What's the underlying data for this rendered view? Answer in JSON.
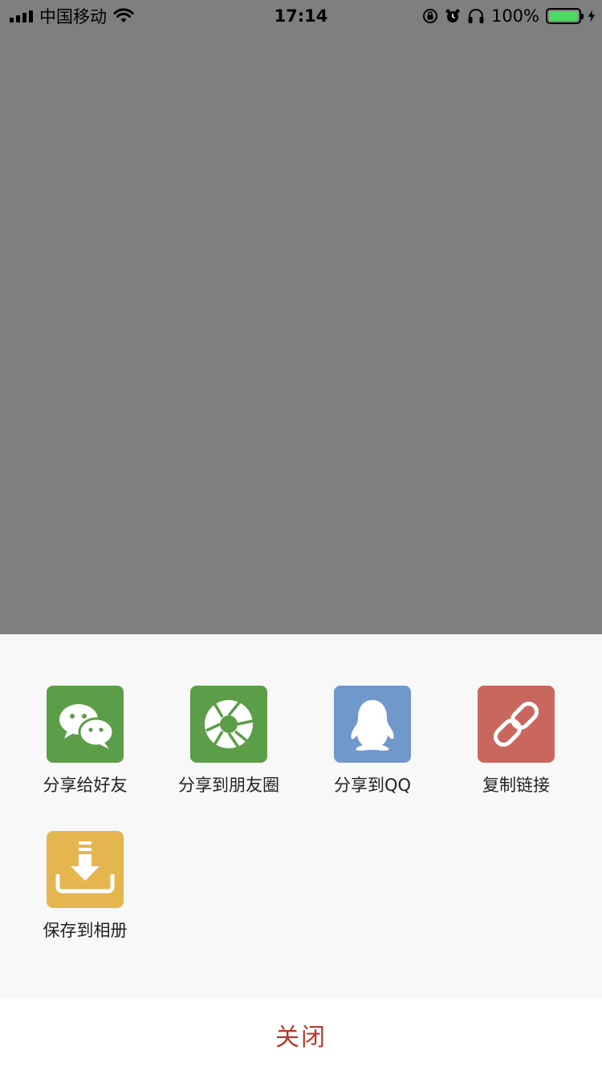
{
  "status_bar": {
    "carrier": "中国移动",
    "time": "17:14",
    "battery": "100%",
    "battery_level": 1.0,
    "icons": [
      "signal-icon",
      "wifi-icon",
      "orientation-lock-icon",
      "alarm-icon",
      "headphones-icon",
      "battery-icon",
      "charging-icon"
    ]
  },
  "share_sheet": {
    "items": [
      {
        "label": "分享给好友",
        "icon": "wechat-icon",
        "color": "#5b9e47"
      },
      {
        "label": "分享到朋友圈",
        "icon": "moments-icon",
        "color": "#5b9e47"
      },
      {
        "label": "分享到QQ",
        "icon": "qq-icon",
        "color": "#7098cb"
      },
      {
        "label": "复制链接",
        "icon": "link-icon",
        "color": "#c9675f"
      },
      {
        "label": "保存到相册",
        "icon": "download-icon",
        "color": "#e5b64f"
      }
    ],
    "close_label": "关闭",
    "close_color": "#b8392b",
    "overlay_color": "#7f7f7f",
    "sheet_color": "#f8f8f8"
  }
}
